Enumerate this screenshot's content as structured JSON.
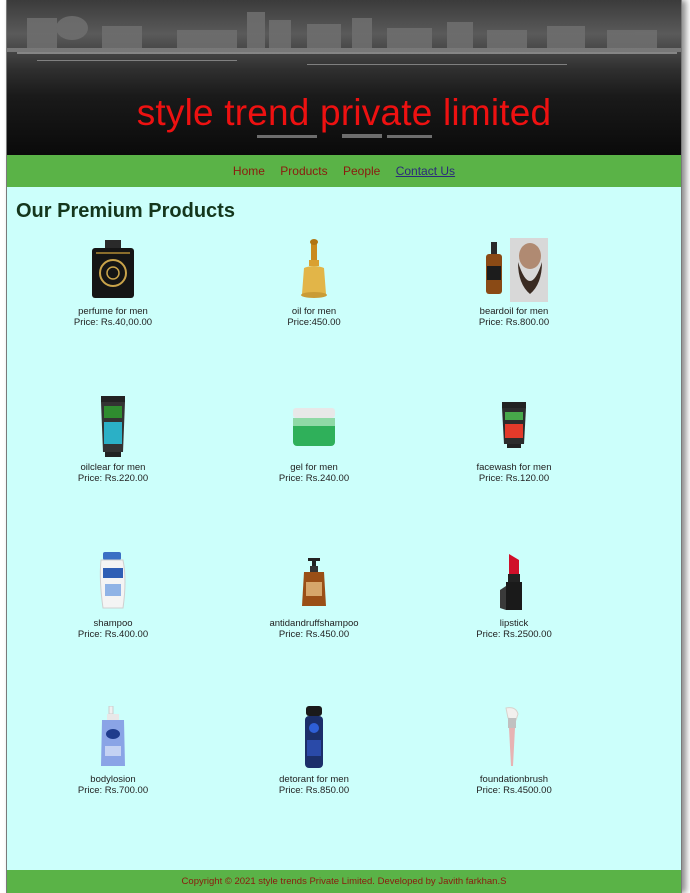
{
  "site": {
    "title": "style trend private limited"
  },
  "nav": {
    "items": [
      "Home",
      "Products",
      "People",
      "Contact Us"
    ]
  },
  "main": {
    "heading": "Our Premium Products"
  },
  "products": [
    {
      "name": "perfume for men",
      "price": "Price: Rs.40,00.00",
      "icon": "perfume-bottle-icon"
    },
    {
      "name": "oil for men",
      "price": "Price:450.00",
      "icon": "oil-dropper-icon"
    },
    {
      "name": "beardoil for men",
      "price": "Price: Rs.800.00",
      "icon": "beard-oil-icon"
    },
    {
      "name": "oilclear for men",
      "price": "Price: Rs.220.00",
      "icon": "oilclear-tube-icon"
    },
    {
      "name": "gel for men",
      "price": "Price: Rs.240.00",
      "icon": "gel-jar-icon"
    },
    {
      "name": "facewash for men",
      "price": "Price: Rs.120.00",
      "icon": "facewash-tube-icon"
    },
    {
      "name": "shampoo",
      "price": "Price: Rs.400.00",
      "icon": "shampoo-bottle-icon"
    },
    {
      "name": "antidandruffshampoo",
      "price": "Price: Rs.450.00",
      "icon": "pump-bottle-icon"
    },
    {
      "name": "lipstick",
      "price": "Price: Rs.2500.00",
      "icon": "lipstick-icon"
    },
    {
      "name": "bodylosion",
      "price": "Price: Rs.700.00",
      "icon": "lotion-bottle-icon"
    },
    {
      "name": "detorant for men",
      "price": "Price: Rs.850.00",
      "icon": "deodorant-can-icon"
    },
    {
      "name": "foundationbrush",
      "price": "Price: Rs.4500.00",
      "icon": "makeup-brush-icon"
    }
  ],
  "footer": {
    "text": "Copyright © 2021 style trends Private Limited. Developed by Javith farkhan.S"
  },
  "colors": {
    "nav_bg": "#5ab347",
    "page_bg": "#ccfffb",
    "title": "#ee1111",
    "link": "#8b1a0e"
  }
}
